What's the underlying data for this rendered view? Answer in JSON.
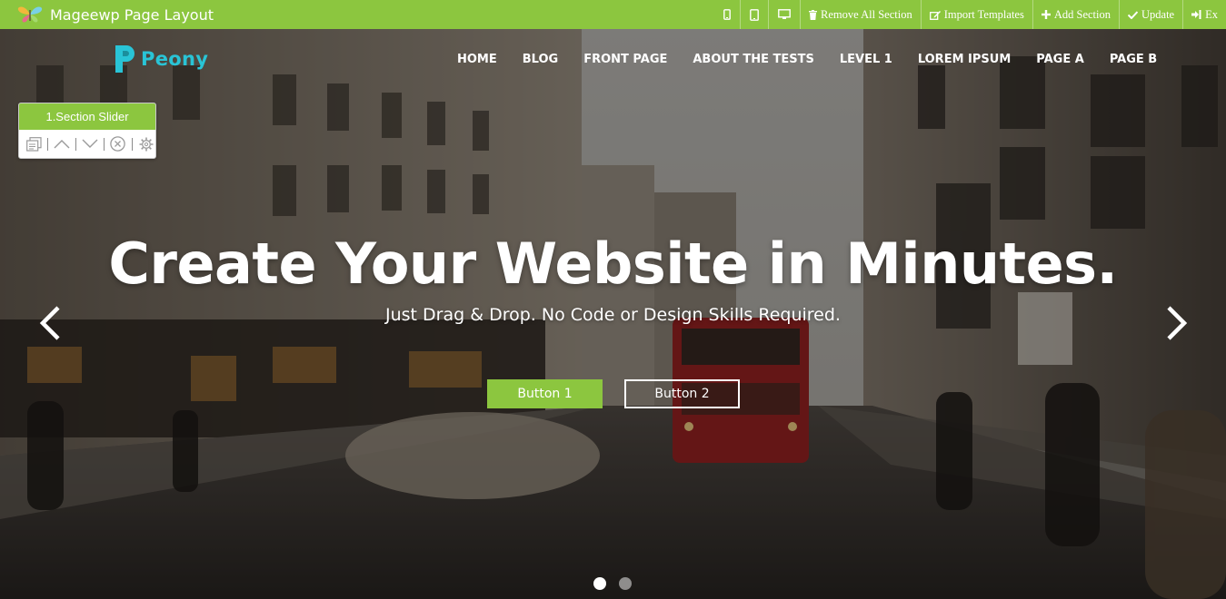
{
  "builder": {
    "title": "Mageewp Page Layout",
    "actions": {
      "remove_all": "Remove All Section",
      "import_templates": "Import Templates",
      "add_section": "Add Section",
      "update": "Update",
      "exit": "Ex"
    },
    "accent_color": "#8cc63f"
  },
  "site": {
    "logo_text": "Peony",
    "logo_color": "#29c4d6",
    "nav": [
      "HOME",
      "BLOG",
      "FRONT PAGE",
      "ABOUT THE TESTS",
      "LEVEL 1",
      "LOREM IPSUM",
      "PAGE A",
      "PAGE B"
    ]
  },
  "section_widget": {
    "label": "1.Section Slider",
    "tools": [
      "copy-icon",
      "chevron-up-icon",
      "chevron-down-icon",
      "close-circle-icon",
      "gear-icon"
    ]
  },
  "slider": {
    "headline": "Create Your Website in Minutes.",
    "subline": "Just Drag & Drop. No Code or Design Skills Required.",
    "button_1": "Button 1",
    "button_2": "Button 2",
    "active_slide": 1,
    "slide_count": 2
  }
}
